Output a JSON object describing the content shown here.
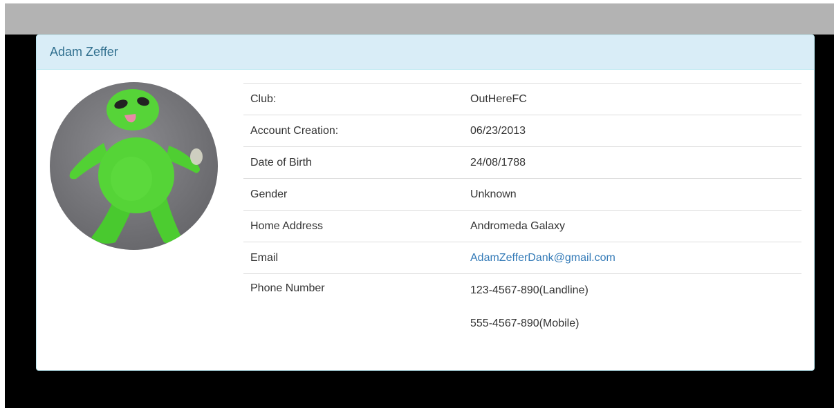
{
  "profile": {
    "name": "Adam Zeffer",
    "avatar_icon": "green-alien-plush-avatar",
    "fields": {
      "club": {
        "label": "Club:",
        "value": "OutHereFC"
      },
      "account_creation": {
        "label": "Account Creation:",
        "value": "06/23/2013"
      },
      "date_of_birth": {
        "label": "Date of Birth",
        "value": "24/08/1788"
      },
      "gender": {
        "label": "Gender",
        "value": "Unknown"
      },
      "home_address": {
        "label": "Home Address",
        "value": "Andromeda Galaxy"
      },
      "email": {
        "label": "Email",
        "value": "AdamZefferDank@gmail.com"
      },
      "phone": {
        "label": "Phone Number",
        "landline": "123-4567-890(Landline)",
        "mobile": "555-4567-890(Mobile)"
      }
    }
  },
  "colors": {
    "heading_bg": "#d9edf7",
    "heading_text": "#31708f",
    "link": "#337ab7",
    "top_bar": "#b3b3b3",
    "backdrop": "#000000"
  }
}
